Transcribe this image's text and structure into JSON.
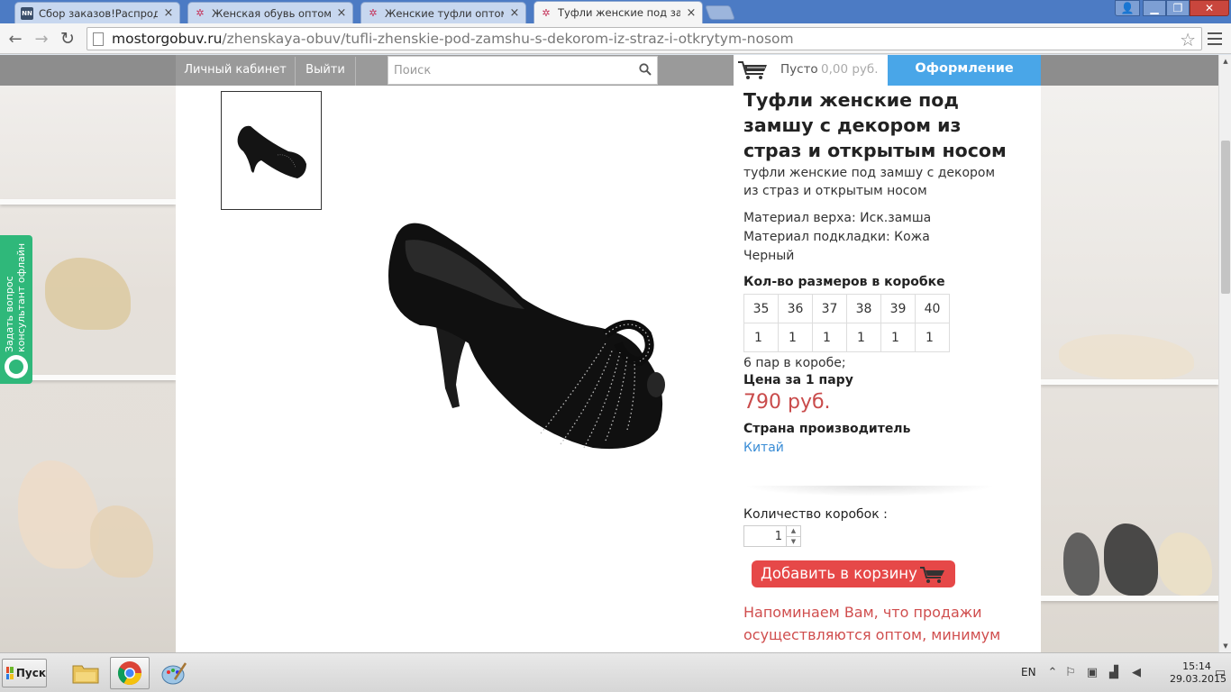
{
  "browser": {
    "tabs": [
      {
        "title": "Сбор заказов!Распродажа",
        "favicon": "nn-favicon",
        "active": false
      },
      {
        "title": "Женская обувь оптом. Куп",
        "favicon": "star-favicon",
        "active": false
      },
      {
        "title": "Женские туфли оптом | Ве",
        "favicon": "star-favicon",
        "active": false
      },
      {
        "title": "Туфли женские под замшу",
        "favicon": "star-favicon",
        "active": true
      }
    ],
    "url_host": "mostorgobuv.ru",
    "url_path": "/zhenskaya-obuv/tufli-zhenskie-pod-zamshu-s-dekorom-iz-straz-i-otkrytym-nosom"
  },
  "sitebar": {
    "account": "Личный кабинет",
    "logout": "Выйти",
    "search_placeholder": "Поиск",
    "cart_empty": "Пусто",
    "cart_sum": "0,00 руб.",
    "checkout": "Оформление заказа"
  },
  "widget": {
    "line1": "Задать вопрос",
    "line2": "консультант офлайн"
  },
  "product": {
    "title": "Туфли женские под замшу с декором из страз и открытым носом",
    "subtitle": "туфли женские под замшу с декором из страз и открытым носом",
    "material_top": "Материал верха: Иск.замша",
    "material_lining": "Материал подкладки: Кожа",
    "color": "Черный",
    "sizes_title": "Кол-во размеров в коробке",
    "sizes": [
      "35",
      "36",
      "37",
      "38",
      "39",
      "40"
    ],
    "size_qty": [
      "1",
      "1",
      "1",
      "1",
      "1",
      "1"
    ],
    "pairs": "6 пар в коробе;",
    "price_title": "Цена за 1 пару",
    "price": "790 руб.",
    "country_title": "Страна производитель",
    "country": "Китай",
    "qty_label": "Количество коробок :",
    "qty_value": "1",
    "add_to_cart": "Добавить в корзину",
    "notice": "Напоминаем Вам, что продажи осуществляются оптом, минимум"
  },
  "taskbar": {
    "start": "Пуск",
    "lang": "EN",
    "time": "15:14",
    "date": "29.03.2015"
  },
  "colors": {
    "accent_blue": "#49a6e8",
    "price_red": "#c94b4b",
    "button_red": "#e64848",
    "widget_green": "#2fb87a"
  }
}
